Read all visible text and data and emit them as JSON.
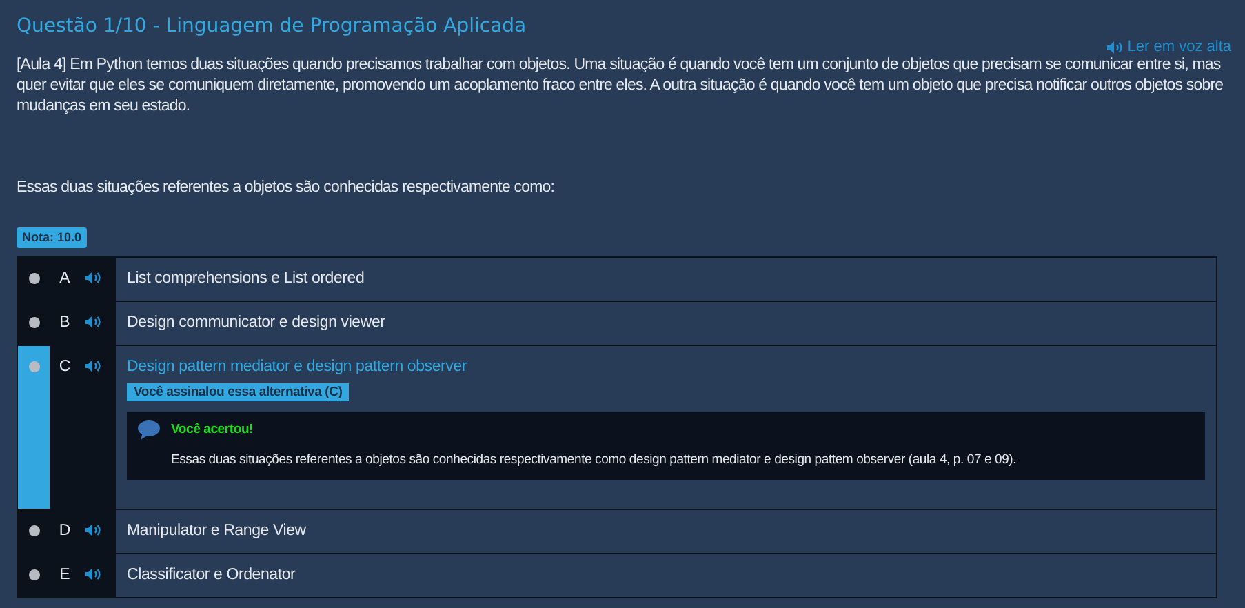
{
  "title": "Questão 1/10 - Linguagem de Programação Aplicada",
  "read_aloud": "Ler em voz alta",
  "question": [
    "[Aula 4] Em Python temos duas situações quando precisamos trabalhar com objetos. Uma situação é quando você tem um conjunto de objetos que precisam se comunicar entre si, mas quer evitar que eles se comuniquem diretamente, promovendo um acoplamento fraco entre eles. A outra situação é quando você tem um objeto que precisa notificar outros objetos sobre mudanças em seu estado.",
    "Essas duas situações referentes a objetos são conhecidas respectivamente como:"
  ],
  "grade": "Nota: 10.0",
  "options": [
    {
      "letter": "A",
      "text": "List comprehensions e List ordered",
      "selected": false
    },
    {
      "letter": "B",
      "text": "Design communicator e design viewer",
      "selected": false
    },
    {
      "letter": "C",
      "text": "Design pattern mediator e design pattern observer",
      "selected": true,
      "marked_label": "Você assinalou essa alternativa (C)",
      "feedback": {
        "title": "Você acertou!",
        "text": "Essas duas situações referentes a objetos são conhecidas respectivamente como design pattern mediator e design pattem observer (aula 4, p. 07 e 09)."
      }
    },
    {
      "letter": "D",
      "text": "Manipulator e Range View",
      "selected": false
    },
    {
      "letter": "E",
      "text": "Classificator e Ordenator",
      "selected": false
    }
  ]
}
